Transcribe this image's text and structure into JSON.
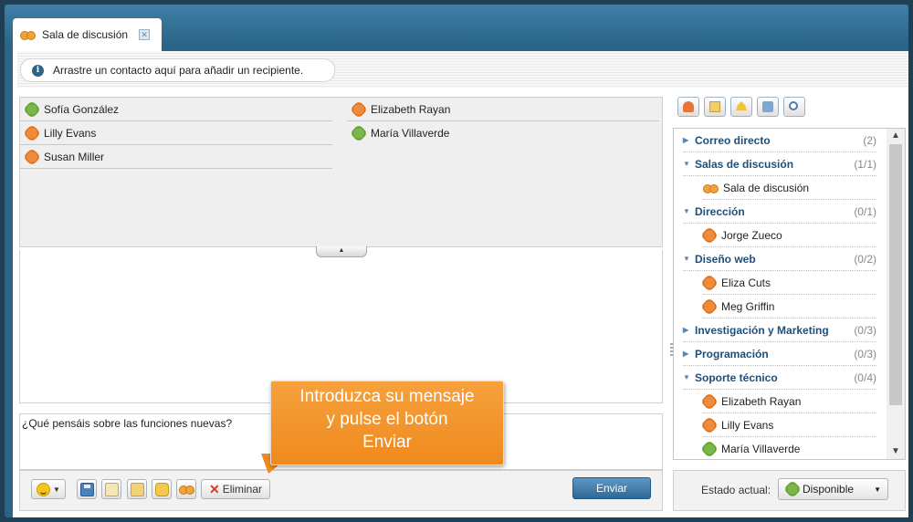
{
  "tab": {
    "title": "Sala de discusión",
    "close_glyph": "✕",
    "icon": "chat-room-icon"
  },
  "infobar": {
    "text": "Arrastre un contacto aquí para añadir un recipiente.",
    "icon_glyph": "i"
  },
  "recipients": [
    {
      "name": "Sofía González",
      "status": "green"
    },
    {
      "name": "Elizabeth Rayan",
      "status": "orange"
    },
    {
      "name": "Lilly Evans",
      "status": "orange"
    },
    {
      "name": "María Villaverde",
      "status": "green"
    },
    {
      "name": "Susan Miller",
      "status": "orange"
    }
  ],
  "collapse_glyph": "▲",
  "message": {
    "value": "¿Qué pensáis sobre las funciones nuevas?"
  },
  "callout": {
    "line1": "Introduzca su mensaje",
    "line2": "y pulse el botón",
    "line3": "Enviar"
  },
  "toolbar": {
    "delete_label": "Eliminar",
    "send_label": "Enviar",
    "dropdown_glyph": "▼",
    "delete_glyph": "✕"
  },
  "side_list": {
    "groups": [
      {
        "label": "Correo directo",
        "count": "(2)",
        "expanded": false
      },
      {
        "label": "Salas de discusión",
        "count": "(1/1)",
        "expanded": true,
        "items": [
          {
            "name": "Sala de discusión",
            "status": "group"
          }
        ]
      },
      {
        "label": "Dirección",
        "count": "(0/1)",
        "expanded": true,
        "items": [
          {
            "name": "Jorge Zueco",
            "status": "orange"
          }
        ]
      },
      {
        "label": "Diseño web",
        "count": "(0/2)",
        "expanded": true,
        "items": [
          {
            "name": "Eliza Cuts",
            "status": "orange"
          },
          {
            "name": "Meg Griffin",
            "status": "orange"
          }
        ]
      },
      {
        "label": "Investigación y Marketing",
        "count": "(0/3)",
        "expanded": false
      },
      {
        "label": "Programación",
        "count": "(0/3)",
        "expanded": false
      },
      {
        "label": "Soporte técnico",
        "count": "(0/4)",
        "expanded": true,
        "items": [
          {
            "name": "Elizabeth Rayan",
            "status": "orange"
          },
          {
            "name": "Lilly Evans",
            "status": "orange"
          },
          {
            "name": "María Villaverde",
            "status": "green"
          }
        ]
      }
    ],
    "arrow_expanded": "▼",
    "arrow_collapsed": "▶",
    "scroll_up": "▲",
    "scroll_down": "▼"
  },
  "status_bar": {
    "label": "Estado actual:",
    "value": "Disponible",
    "dropdown_glyph": "▼"
  },
  "colors": {
    "accent": "#2a6488",
    "available": "#7ab648",
    "away": "#f08b3a",
    "callout": "#f29428"
  }
}
